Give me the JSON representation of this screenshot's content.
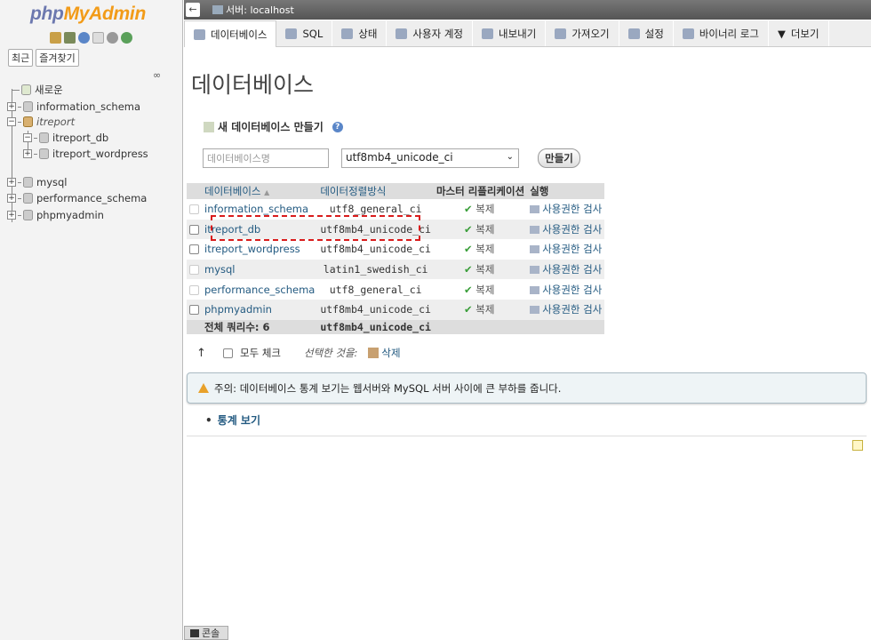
{
  "logo": {
    "php": "php",
    "myadmin": "MyAdmin"
  },
  "nav": {
    "recent": "최근",
    "favorites": "즐겨찾기"
  },
  "tree": {
    "new": "새로운",
    "items": [
      "information_schema",
      "itreport",
      "itreport_db",
      "itreport_wordpress",
      "mysql",
      "performance_schema",
      "phpmyadmin"
    ]
  },
  "topbar": {
    "back": "←",
    "server": "서버: localhost"
  },
  "tabs": [
    "데이터베이스",
    "SQL",
    "상태",
    "사용자 계정",
    "내보내기",
    "가져오기",
    "설정",
    "바이너리 로그",
    "더보기"
  ],
  "page_title": "데이터베이스",
  "create": {
    "heading": "새 데이터베이스 만들기",
    "help": "?",
    "name_placeholder": "데이터베이스명",
    "collation": "utf8mb4_unicode_ci",
    "button": "만들기"
  },
  "table": {
    "headers": {
      "database": "데이터베이스",
      "sort": "▲",
      "collation": "데이터정렬방식",
      "replication": "마스터 리플리케이션",
      "action": "실행"
    },
    "rows": [
      {
        "name": "information_schema",
        "collation": "utf8_general_ci",
        "repl": "복제",
        "priv": "사용권한 검사"
      },
      {
        "name": "itreport_db",
        "collation": "utf8mb4_unicode_ci",
        "repl": "복제",
        "priv": "사용권한 검사"
      },
      {
        "name": "itreport_wordpress",
        "collation": "utf8mb4_unicode_ci",
        "repl": "복제",
        "priv": "사용권한 검사"
      },
      {
        "name": "mysql",
        "collation": "latin1_swedish_ci",
        "repl": "복제",
        "priv": "사용권한 검사"
      },
      {
        "name": "performance_schema",
        "collation": "utf8_general_ci",
        "repl": "복제",
        "priv": "사용권한 검사"
      },
      {
        "name": "phpmyadmin",
        "collation": "utf8mb4_unicode_ci",
        "repl": "복제",
        "priv": "사용권한 검사"
      }
    ],
    "footer": {
      "total": "전체 쿼리수: 6",
      "collation": "utf8mb4_unicode_ci"
    }
  },
  "with_selected": {
    "arrow": "↑",
    "check_all": "모두 체크",
    "selected": "선택한 것을:",
    "delete": "삭제"
  },
  "notice": "주의: 데이터베이스 통계 보기는 웹서버와 MySQL 서버 사이에 큰 부하를 줍니다.",
  "stats_link": "통계 보기",
  "console": "콘솔",
  "colors": {
    "link": "#235a81",
    "highlight": "#d91c1c",
    "warn": "#e8a12a"
  }
}
